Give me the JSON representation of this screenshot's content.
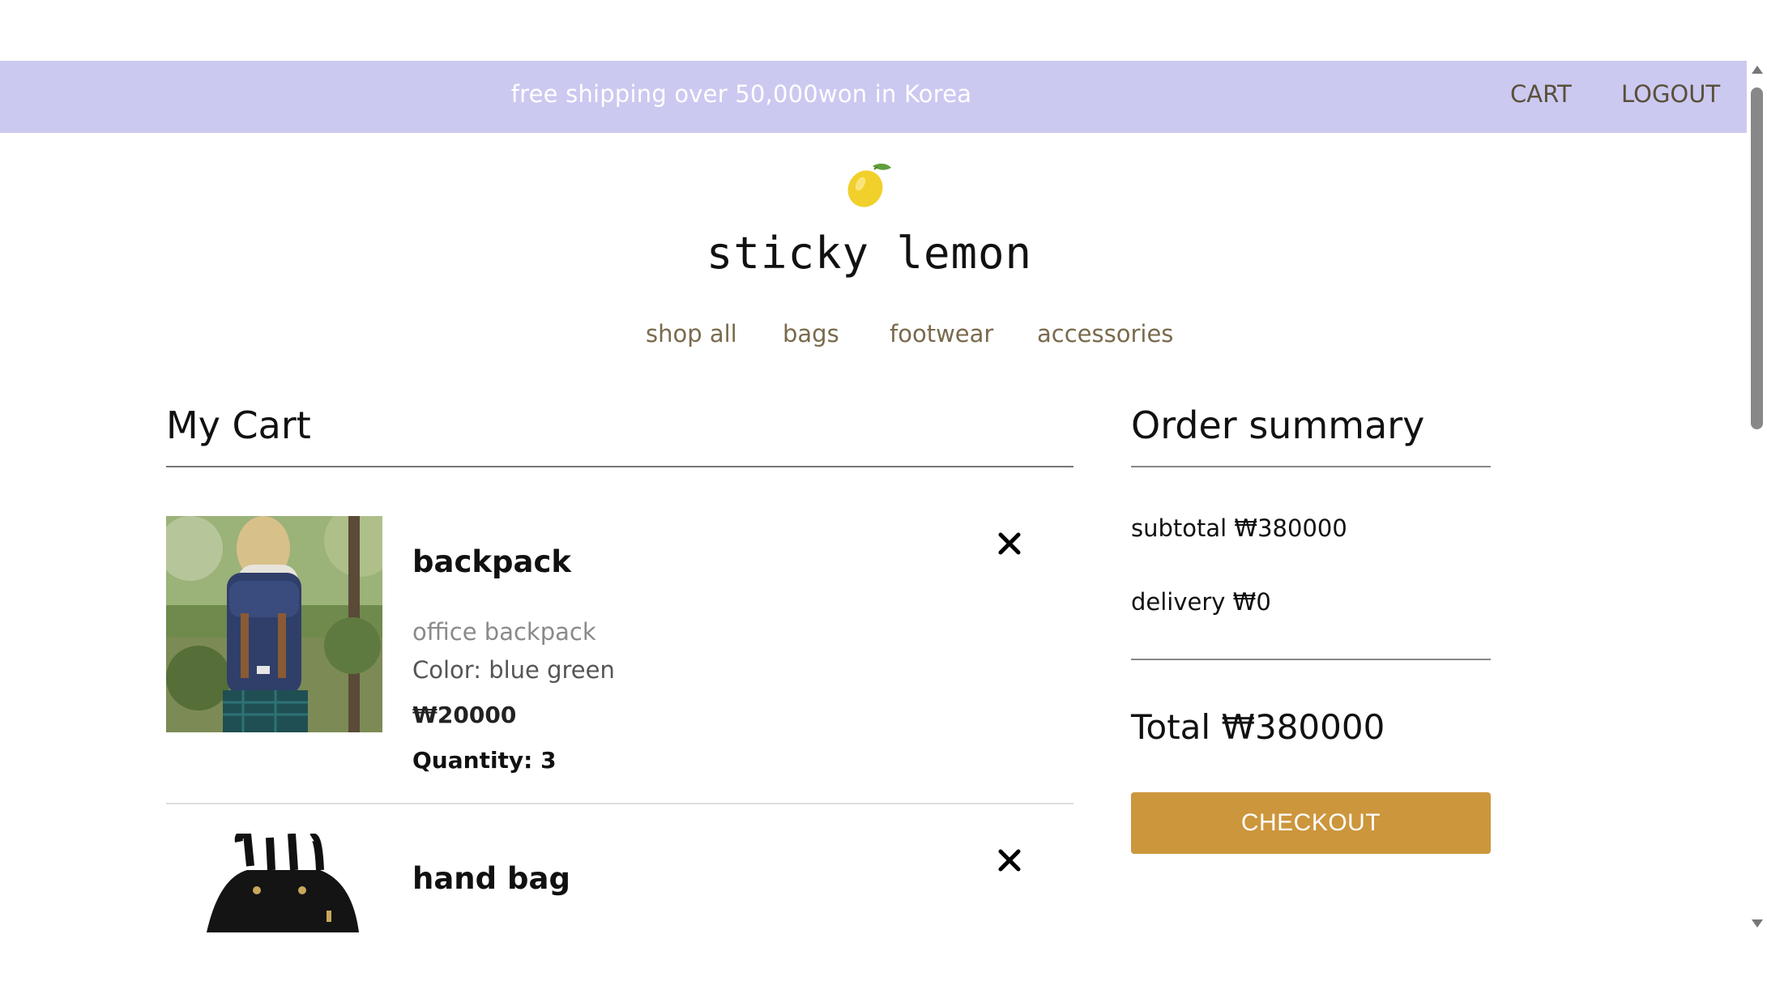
{
  "promo": {
    "text": "free shipping over 50,000won in Korea"
  },
  "top_links": {
    "cart": "CART",
    "logout": "LOGOUT"
  },
  "brand": {
    "name": "sticky lemon",
    "logo_icon": "lemon-icon"
  },
  "nav": {
    "items": [
      {
        "label": "shop all"
      },
      {
        "label": "bags"
      },
      {
        "label": "footwear"
      },
      {
        "label": "accessories"
      }
    ]
  },
  "cart": {
    "title": "My Cart",
    "items": [
      {
        "name": "backpack",
        "description": "office backpack",
        "color": "Color: blue green",
        "price": "₩20000",
        "quantity": "Quantity: 3",
        "image": "backpack-photo"
      },
      {
        "name": "hand bag",
        "image": "handbag-photo"
      }
    ]
  },
  "summary": {
    "title": "Order summary",
    "subtotal": "subtotal ₩380000",
    "delivery": "delivery ₩0",
    "total": "Total ₩380000",
    "checkout_label": "CHECKOUT"
  },
  "colors": {
    "promo_bar": "#cbc9f0",
    "accent": "#cc963c",
    "nav_text": "#7a6a4d"
  }
}
